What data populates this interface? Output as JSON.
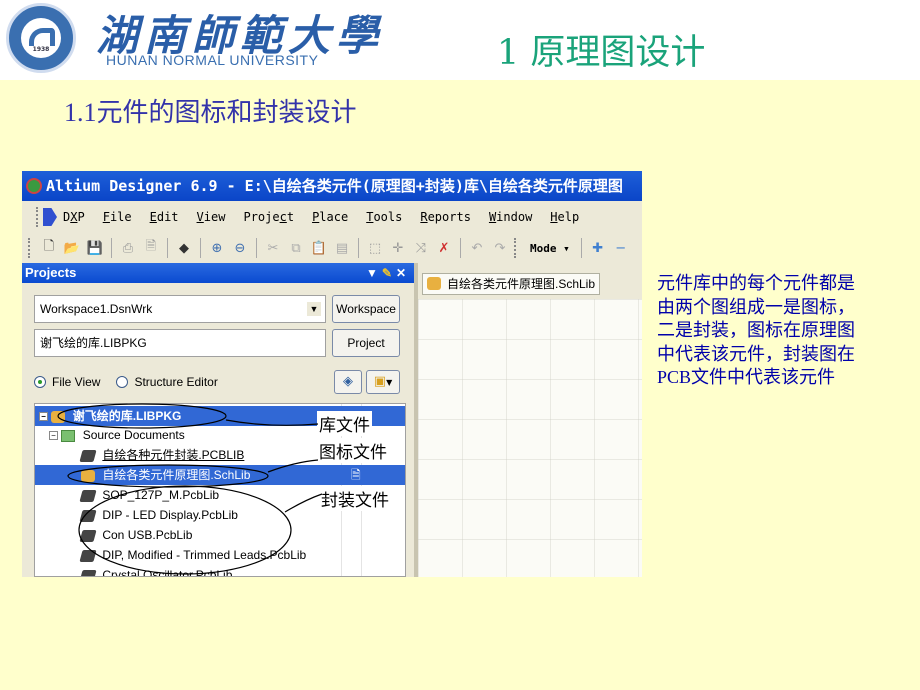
{
  "header": {
    "university_cn": "湖南師範大學",
    "university_en": "HUNAN NORMAL UNIVERSITY",
    "logo_year": "1938",
    "page_title": "1 原理图设计",
    "subtitle": "1.1元件的图标和封装设计"
  },
  "app": {
    "title": "Altium Designer 6.9 - E:\\自绘各类元件(原理图+封装)库\\自绘各类元件原理图",
    "menu": [
      {
        "pre": "D",
        "ul": "X",
        "post": "P"
      },
      {
        "pre": "",
        "ul": "F",
        "post": "ile"
      },
      {
        "pre": "",
        "ul": "E",
        "post": "dit"
      },
      {
        "pre": "",
        "ul": "V",
        "post": "iew"
      },
      {
        "pre": "Proje",
        "ul": "c",
        "post": "t"
      },
      {
        "pre": "",
        "ul": "P",
        "post": "lace"
      },
      {
        "pre": "",
        "ul": "T",
        "post": "ools"
      },
      {
        "pre": "",
        "ul": "R",
        "post": "eports"
      },
      {
        "pre": "",
        "ul": "W",
        "post": "indow"
      },
      {
        "pre": "",
        "ul": "H",
        "post": "elp"
      }
    ],
    "toolbar": {
      "mode_label": "Mode ▾",
      "icons": [
        "new-document-icon",
        "open-folder-icon",
        "save-icon",
        "print-icon",
        "print-preview-icon",
        "3d-view-icon",
        "zoom-in-icon",
        "zoom-out-icon",
        "cut-icon",
        "copy-icon",
        "paste-icon",
        "rubber-stamp-icon",
        "select-area-icon",
        "move-icon",
        "cross-select-icon",
        "clear-filter-icon",
        "undo-icon",
        "redo-icon"
      ]
    },
    "projects_panel": {
      "title": "Projects",
      "workspace_value": "Workspace1.DsnWrk",
      "workspace_button": "Workspace",
      "project_value": "谢飞绘的库.LIBPKG",
      "project_button": "Project",
      "radio_file_view": "File View",
      "radio_structure_editor": "Structure Editor",
      "selected_view": "File View",
      "tree": [
        {
          "label": "谢飞绘的库.LIBPKG",
          "type": "libpkg",
          "selected": true
        },
        {
          "label": "Source Documents",
          "type": "folder"
        },
        {
          "label": "自绘各种元件封装.PCBLIB",
          "type": "pcblib"
        },
        {
          "label": "自绘各类元件原理图.SchLib",
          "type": "schlib",
          "selected": true
        },
        {
          "label": "SOP_127P_M.PcbLib",
          "type": "pcblib"
        },
        {
          "label": "DIP - LED Display.PcbLib",
          "type": "pcblib"
        },
        {
          "label": "Con USB.PcbLib",
          "type": "pcblib"
        },
        {
          "label": "DIP, Modified - Trimmed Leads.PcbLib",
          "type": "pcblib"
        },
        {
          "label": "Crystal Oscillator.PcbLib",
          "type": "pcblib"
        }
      ]
    },
    "editor": {
      "tab_label": "自绘各类元件原理图.SchLib"
    },
    "callouts": {
      "library_file": "库文件",
      "symbol_file": "图标文件",
      "footprint_file": "封装文件"
    }
  },
  "description": "元件库中的每个元件都是由两个图组成一是图标，二是封装，图标在原理图中代表该元件，封装图在PCB文件中代表该元件"
}
